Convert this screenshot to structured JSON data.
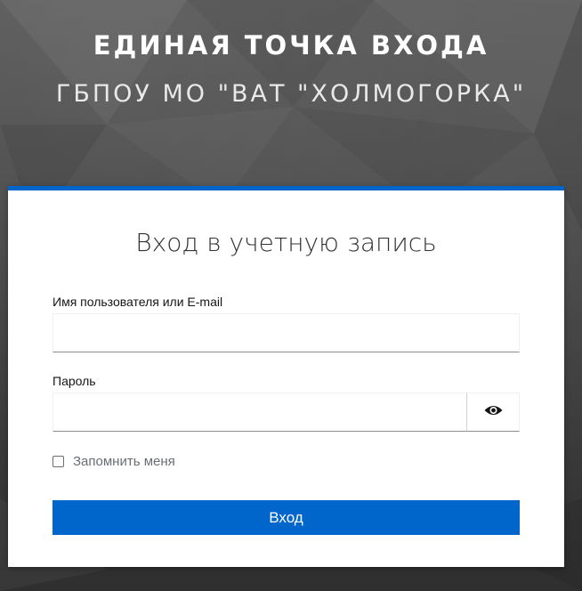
{
  "header": {
    "title": "ЕДИНАЯ ТОЧКА ВХОДА",
    "subtitle": "ГБПОУ МО \"ВАТ \"ХОЛМОГОРКА\""
  },
  "login_form": {
    "title": "Вход в учетную запись",
    "username_label": "Имя пользователя или E-mail",
    "username_value": "",
    "password_label": "Пароль",
    "password_value": "",
    "show_password_icon": "eye-icon",
    "remember_me_label": "Запомнить меня",
    "remember_me_checked": false,
    "submit_label": "Вход"
  },
  "colors": {
    "accent": "#0066cc",
    "background": "#4b4b4b",
    "card": "#ffffff"
  }
}
